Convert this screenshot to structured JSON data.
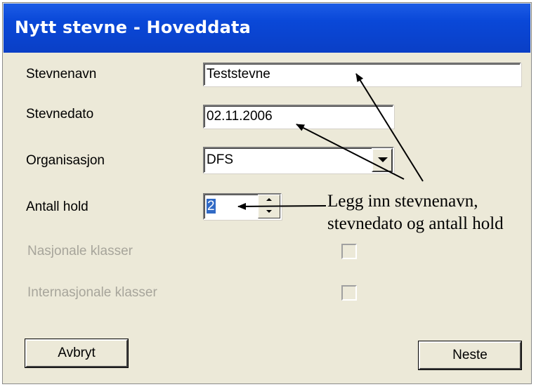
{
  "window": {
    "title": "Nytt stevne - Hoveddata"
  },
  "form": {
    "stevnenavn": {
      "label": "Stevnenavn",
      "value": "Teststevne"
    },
    "stevnedato": {
      "label": "Stevnedato",
      "value": "02.11.2006"
    },
    "organisasjon": {
      "label": "Organisasjon",
      "value": "DFS"
    },
    "antall_hold": {
      "label": "Antall hold",
      "value": "2"
    },
    "nasjonale_klasser": {
      "label": "Nasjonale klasser",
      "checked": false,
      "enabled": false
    },
    "internasjonale_klasser": {
      "label": "Internasjonale klasser",
      "checked": false,
      "enabled": false
    }
  },
  "buttons": {
    "cancel_label": "Avbryt",
    "next_label": "Neste"
  },
  "annotation": {
    "line1": "Legg inn stevnenavn,",
    "line2": "stevnedato og antall hold"
  },
  "colors": {
    "titlebar": "#0a48d8",
    "dialog_background": "#ece9d8",
    "selection": "#316ac5",
    "disabled_text": "#a7a59b"
  }
}
